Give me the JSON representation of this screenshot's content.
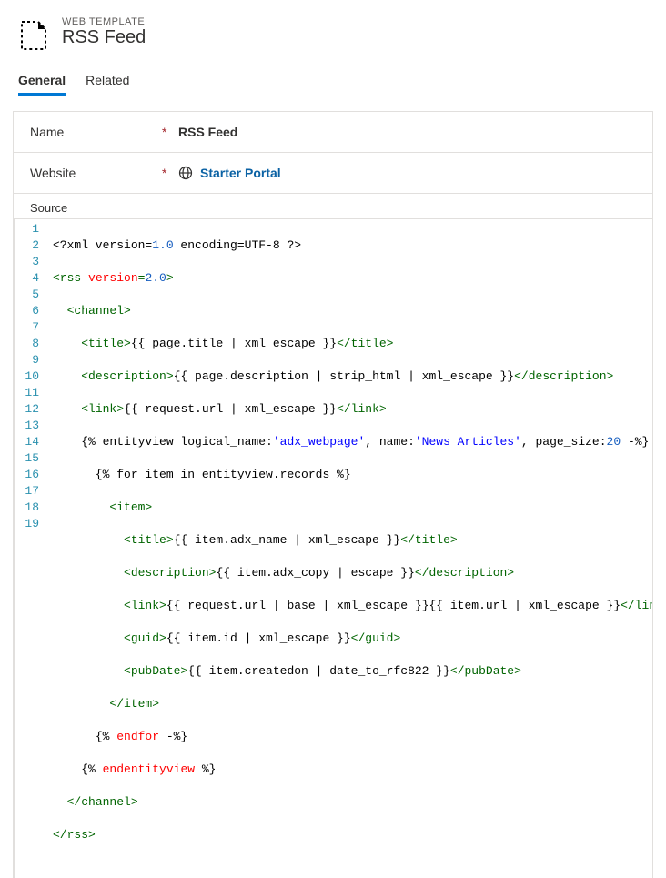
{
  "header": {
    "subtitle": "WEB TEMPLATE",
    "title": "RSS Feed"
  },
  "tabs": {
    "general": "General",
    "related": "Related"
  },
  "form": {
    "name_label": "Name",
    "name_value": "RSS Feed",
    "website_label": "Website",
    "website_value": "Starter Portal",
    "required_marker": "*"
  },
  "source": {
    "label": "Source",
    "line_numbers": [
      "1",
      "2",
      "3",
      "4",
      "5",
      "6",
      "7",
      "8",
      "9",
      "10",
      "11",
      "12",
      "13",
      "14",
      "15",
      "16",
      "17",
      "18",
      "19"
    ]
  },
  "code": {
    "l1_a": "<?xml version=",
    "l1_b": "1.0",
    "l1_c": " encoding=",
    "l1_d": "UTF-8",
    "l1_e": " ?>",
    "l2_a": "<rss ",
    "l2_b": "version",
    "l2_c": "=",
    "l2_d": "2.0",
    "l2_e": ">",
    "l3_a": "  ",
    "l3_b": "<channel>",
    "l4_a": "    ",
    "l4_b": "<title>",
    "l4_c": "{{ page.title | xml_escape }}",
    "l4_d": "</title>",
    "l5_a": "    ",
    "l5_b": "<description>",
    "l5_c": "{{ page.description | strip_html | xml_escape }}",
    "l5_d": "</description>",
    "l6_a": "    ",
    "l6_b": "<link>",
    "l6_c": "{{ request.url | xml_escape }}",
    "l6_d": "</link>",
    "l7_a": "    {% entityview logical_name:",
    "l7_b": "'adx_webpage'",
    "l7_c": ", name:",
    "l7_d": "'News Articles'",
    "l7_e": ", page_size:",
    "l7_f": "20",
    "l7_g": " -%}",
    "l8_a": "      {% for item in entityview.records %}",
    "l9_a": "        ",
    "l9_b": "<item>",
    "l10_a": "          ",
    "l10_b": "<title>",
    "l10_c": "{{ item.adx_name | xml_escape }}",
    "l10_d": "</title>",
    "l11_a": "          ",
    "l11_b": "<description>",
    "l11_c": "{{ item.adx_copy | escape }}",
    "l11_d": "</description>",
    "l12_a": "          ",
    "l12_b": "<link>",
    "l12_c": "{{ request.url | base | xml_escape }}{{ item.url | xml_escape }}",
    "l12_d": "</link>",
    "l13_a": "          ",
    "l13_b": "<guid>",
    "l13_c": "{{ item.id | xml_escape }}",
    "l13_d": "</guid>",
    "l14_a": "          ",
    "l14_b": "<pubDate>",
    "l14_c": "{{ item.createdon | date_to_rfc822 }}",
    "l14_d": "</pubDate>",
    "l15_a": "        ",
    "l15_b": "</item>",
    "l16_a": "      ",
    "l16_b": "{% ",
    "l16_c": "endfor",
    "l16_d": " -%}",
    "l17_a": "    ",
    "l17_b": "{% ",
    "l17_c": "endentityview",
    "l17_d": " %}",
    "l18_a": "  ",
    "l18_b": "</channel>",
    "l19_a": "</rss>"
  }
}
